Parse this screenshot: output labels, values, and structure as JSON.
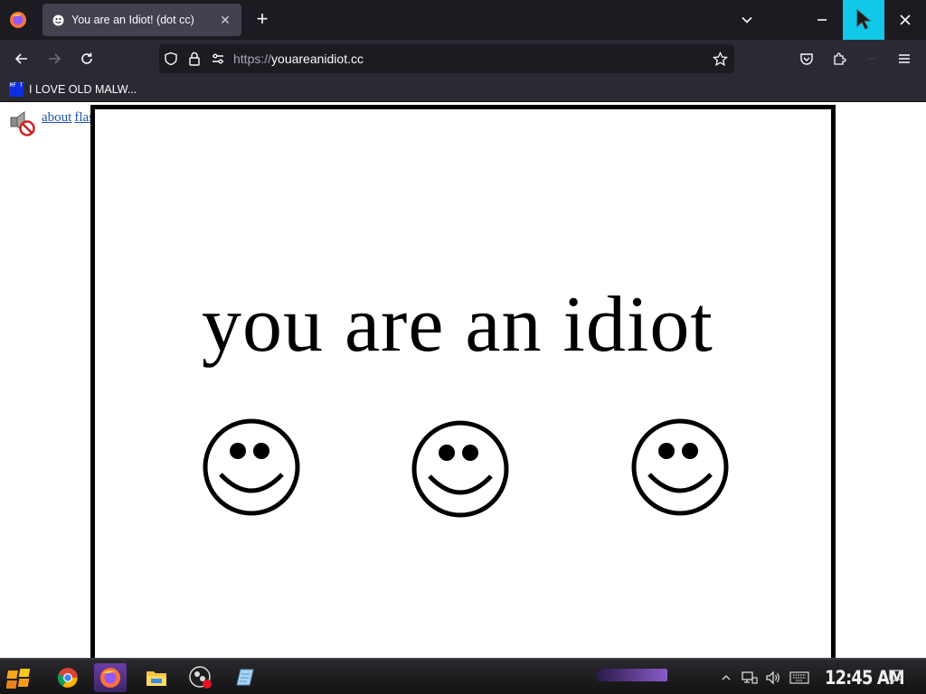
{
  "browser": {
    "tab": {
      "title": "You are an Idiot! (dot cc)"
    },
    "url": {
      "scheme": "https://",
      "host": "youareanidiot.cc"
    },
    "bookmarks": [
      {
        "icon_text": "MF T",
        "label": "I LOVE OLD MALW..."
      }
    ],
    "accent_color": "#12c8e8"
  },
  "page": {
    "links": [
      "about",
      "flash"
    ],
    "headline": "you are an idiot",
    "smiley_count": 3
  },
  "taskbar": {
    "apps": [
      "start-icon",
      "chrome-icon",
      "firefox-icon",
      "file-explorer-icon",
      "obs-icon",
      "notepad-icon"
    ],
    "clock": "12:45 AM"
  }
}
